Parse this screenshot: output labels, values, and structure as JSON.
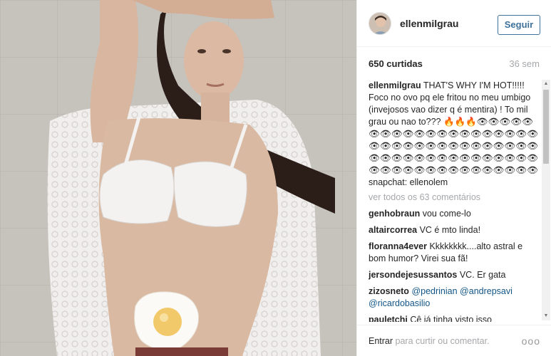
{
  "post": {
    "image_alt": "Woman lying on a white crochet blanket with a fried egg on her stomach"
  },
  "header": {
    "username": "ellenmilgrau",
    "follow_label": "Seguir"
  },
  "stats": {
    "likes": "650 curtidas",
    "time": "36 sem"
  },
  "caption": {
    "username": "ellenmilgrau",
    "text": "THAT'S WHY I'M HOT!!!!! Foco no ovo pq ele fritou no meu umbigo (invejosos vao dizer q é mentira) ! To mil grau ou nao to??? 🔥🔥🔥👁👁👁👁👁👁👁👁👁👁👁👁👁👁👁👁👁👁👁👁👁👁👁👁👁👁👁👁👁👁👁👁👁👁👁👁👁👁👁👁👁👁👁👁👁👁👁👁👁👁👁👁👁👁👁👁👁👁👁👁👁👁👁👁👁 snapchat: ellenolem"
  },
  "view_all": "ver todos os 63 comentários",
  "comments": [
    {
      "user": "genhobraun",
      "text": "vou come-lo"
    },
    {
      "user": "altaircorrea",
      "text": "VC é mto linda!"
    },
    {
      "user": "floranna4ever",
      "text": "Kkkkkkkk....alto astral e bom humor? Virei sua fã!"
    },
    {
      "user": "jersondejesussantos",
      "text": "VC. Er gata"
    },
    {
      "user": "zizosneto",
      "mentions": [
        "@pedrinian",
        "@andrepsavi",
        "@ricardobasilio"
      ]
    },
    {
      "user": "pauletchi",
      "text": "Cê já tinha visto isso"
    }
  ],
  "footer": {
    "login_label": "Entrar",
    "rest": "para curtir ou comentar.",
    "more_icon": "ooo"
  },
  "colors": {
    "link": "#125688",
    "follow": "#3f729b",
    "muted": "#a5a7aa"
  }
}
